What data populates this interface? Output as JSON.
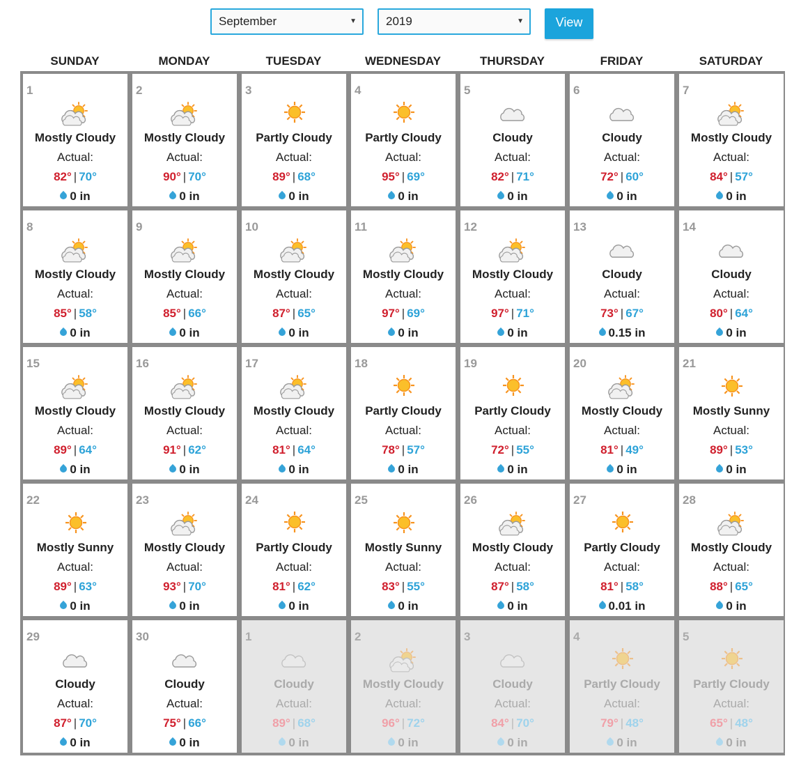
{
  "controls": {
    "month": "September",
    "year": "2019",
    "view_label": "View"
  },
  "weekdays": [
    "SUNDAY",
    "MONDAY",
    "TUESDAY",
    "WEDNESDAY",
    "THURSDAY",
    "FRIDAY",
    "SATURDAY"
  ],
  "actual_label": "Actual:",
  "colors": {
    "high": "#d0202e",
    "low": "#2ea3d8",
    "accent": "#1ba4dc",
    "grid": "#8a8a8a"
  },
  "days": [
    {
      "day": "1",
      "icon": "mostly-cloudy-icon",
      "condition": "Mostly Cloudy",
      "high": "82°",
      "low": "70°",
      "precip": "0 in"
    },
    {
      "day": "2",
      "icon": "mostly-cloudy-icon",
      "condition": "Mostly Cloudy",
      "high": "90°",
      "low": "70°",
      "precip": "0 in"
    },
    {
      "day": "3",
      "icon": "partly-cloudy-icon",
      "condition": "Partly Cloudy",
      "high": "89°",
      "low": "68°",
      "precip": "0 in"
    },
    {
      "day": "4",
      "icon": "partly-cloudy-icon",
      "condition": "Partly Cloudy",
      "high": "95°",
      "low": "69°",
      "precip": "0 in"
    },
    {
      "day": "5",
      "icon": "cloudy-icon",
      "condition": "Cloudy",
      "high": "82°",
      "low": "71°",
      "precip": "0 in"
    },
    {
      "day": "6",
      "icon": "cloudy-icon",
      "condition": "Cloudy",
      "high": "72°",
      "low": "60°",
      "precip": "0 in"
    },
    {
      "day": "7",
      "icon": "mostly-cloudy-icon",
      "condition": "Mostly Cloudy",
      "high": "84°",
      "low": "57°",
      "precip": "0 in"
    },
    {
      "day": "8",
      "icon": "mostly-cloudy-icon",
      "condition": "Mostly Cloudy",
      "high": "85°",
      "low": "58°",
      "precip": "0 in"
    },
    {
      "day": "9",
      "icon": "mostly-cloudy-icon",
      "condition": "Mostly Cloudy",
      "high": "85°",
      "low": "66°",
      "precip": "0 in"
    },
    {
      "day": "10",
      "icon": "mostly-cloudy-icon",
      "condition": "Mostly Cloudy",
      "high": "87°",
      "low": "65°",
      "precip": "0 in"
    },
    {
      "day": "11",
      "icon": "mostly-cloudy-icon",
      "condition": "Mostly Cloudy",
      "high": "97°",
      "low": "69°",
      "precip": "0 in"
    },
    {
      "day": "12",
      "icon": "mostly-cloudy-icon",
      "condition": "Mostly Cloudy",
      "high": "97°",
      "low": "71°",
      "precip": "0 in"
    },
    {
      "day": "13",
      "icon": "cloudy-icon",
      "condition": "Cloudy",
      "high": "73°",
      "low": "67°",
      "precip": "0.15 in"
    },
    {
      "day": "14",
      "icon": "cloudy-icon",
      "condition": "Cloudy",
      "high": "80°",
      "low": "64°",
      "precip": "0 in"
    },
    {
      "day": "15",
      "icon": "mostly-cloudy-icon",
      "condition": "Mostly Cloudy",
      "high": "89°",
      "low": "64°",
      "precip": "0 in"
    },
    {
      "day": "16",
      "icon": "mostly-cloudy-icon",
      "condition": "Mostly Cloudy",
      "high": "91°",
      "low": "62°",
      "precip": "0 in"
    },
    {
      "day": "17",
      "icon": "mostly-cloudy-icon",
      "condition": "Mostly Cloudy",
      "high": "81°",
      "low": "64°",
      "precip": "0 in"
    },
    {
      "day": "18",
      "icon": "partly-cloudy-icon",
      "condition": "Partly Cloudy",
      "high": "78°",
      "low": "57°",
      "precip": "0 in"
    },
    {
      "day": "19",
      "icon": "partly-cloudy-icon",
      "condition": "Partly Cloudy",
      "high": "72°",
      "low": "55°",
      "precip": "0 in"
    },
    {
      "day": "20",
      "icon": "mostly-cloudy-icon",
      "condition": "Mostly Cloudy",
      "high": "81°",
      "low": "49°",
      "precip": "0 in"
    },
    {
      "day": "21",
      "icon": "mostly-sunny-icon",
      "condition": "Mostly Sunny",
      "high": "89°",
      "low": "53°",
      "precip": "0 in"
    },
    {
      "day": "22",
      "icon": "mostly-sunny-icon",
      "condition": "Mostly Sunny",
      "high": "89°",
      "low": "63°",
      "precip": "0 in"
    },
    {
      "day": "23",
      "icon": "mostly-cloudy-icon",
      "condition": "Mostly Cloudy",
      "high": "93°",
      "low": "70°",
      "precip": "0 in"
    },
    {
      "day": "24",
      "icon": "partly-cloudy-icon",
      "condition": "Partly Cloudy",
      "high": "81°",
      "low": "62°",
      "precip": "0 in"
    },
    {
      "day": "25",
      "icon": "mostly-sunny-icon",
      "condition": "Mostly Sunny",
      "high": "83°",
      "low": "55°",
      "precip": "0 in"
    },
    {
      "day": "26",
      "icon": "mostly-cloudy-icon",
      "condition": "Mostly Cloudy",
      "high": "87°",
      "low": "58°",
      "precip": "0 in"
    },
    {
      "day": "27",
      "icon": "partly-cloudy-icon",
      "condition": "Partly Cloudy",
      "high": "81°",
      "low": "58°",
      "precip": "0.01 in"
    },
    {
      "day": "28",
      "icon": "mostly-cloudy-icon",
      "condition": "Mostly Cloudy",
      "high": "88°",
      "low": "65°",
      "precip": "0 in"
    },
    {
      "day": "29",
      "icon": "cloudy-icon",
      "condition": "Cloudy",
      "high": "87°",
      "low": "70°",
      "precip": "0 in"
    },
    {
      "day": "30",
      "icon": "cloudy-icon",
      "condition": "Cloudy",
      "high": "75°",
      "low": "66°",
      "precip": "0 in"
    },
    {
      "day": "1",
      "icon": "cloudy-icon",
      "condition": "Cloudy",
      "high": "89°",
      "low": "68°",
      "precip": "0 in",
      "other": true
    },
    {
      "day": "2",
      "icon": "mostly-cloudy-icon",
      "condition": "Mostly Cloudy",
      "high": "96°",
      "low": "72°",
      "precip": "0 in",
      "other": true
    },
    {
      "day": "3",
      "icon": "cloudy-icon",
      "condition": "Cloudy",
      "high": "84°",
      "low": "70°",
      "precip": "0 in",
      "other": true
    },
    {
      "day": "4",
      "icon": "partly-cloudy-icon",
      "condition": "Partly Cloudy",
      "high": "79°",
      "low": "48°",
      "precip": "0 in",
      "other": true
    },
    {
      "day": "5",
      "icon": "partly-cloudy-icon",
      "condition": "Partly Cloudy",
      "high": "65°",
      "low": "48°",
      "precip": "0 in",
      "other": true
    }
  ]
}
